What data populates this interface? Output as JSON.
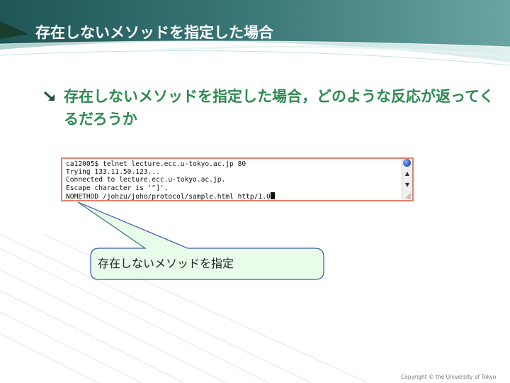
{
  "slide": {
    "title": "存在しないメソッドを指定した場合",
    "bullet": "存在しないメソッドを指定した場合，どのような反応が返ってくるだろうか",
    "callout": "存在しないメソッドを指定",
    "copyright": "Copyright © the University of Tokyo"
  },
  "terminal": {
    "line1": "ca12005$ telnet lecture.ecc.u-tokyo.ac.jp 80",
    "line2": "Trying 133.11.50.123...",
    "line3": "Connected to lecture.ecc.u-tokyo.ac.jp.",
    "line4": "Escape character is '^]'.",
    "line5": "NOMETHOD /johzu/joho/protocol/sample.html http/1.0"
  },
  "colors": {
    "header_dark": "#2f6a6a",
    "header_light": "#9fc9c6",
    "bullet_green": "#2c8a50",
    "terminal_border": "#e0826a",
    "callout_fill": "#e9fbe9",
    "callout_border": "#3a5aa8"
  },
  "icons": {
    "bullet": "diagonal-arrow-icon",
    "scroll_up": "arrow-up-icon",
    "scroll_down": "arrow-down-icon"
  }
}
